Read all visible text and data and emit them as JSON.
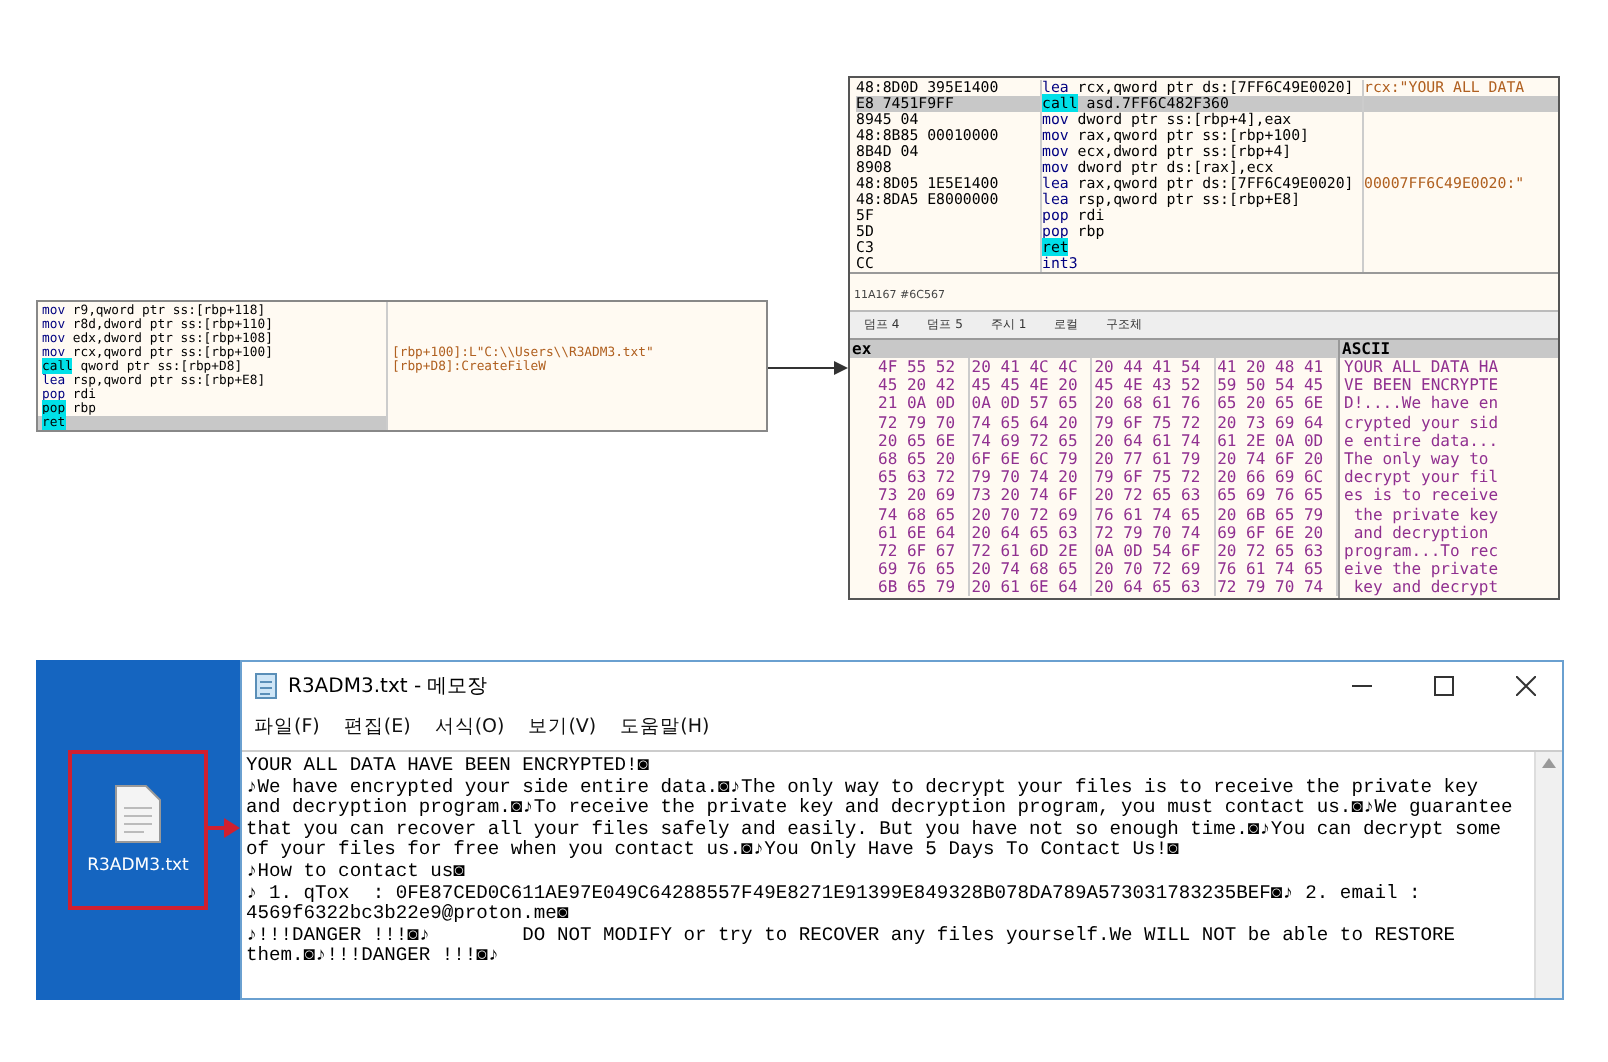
{
  "code_panel": {
    "rows": [
      {
        "mnemonic": "mov",
        "highlight": false,
        "operands": "r9,qword ptr ss:[rbp+118]",
        "comment": "",
        "selected": false
      },
      {
        "mnemonic": "mov",
        "highlight": false,
        "operands": "r8d,dword ptr ss:[rbp+110]",
        "comment": "",
        "selected": false
      },
      {
        "mnemonic": "mov",
        "highlight": false,
        "operands": "edx,dword ptr ss:[rbp+108]",
        "comment": "",
        "selected": false
      },
      {
        "mnemonic": "mov",
        "highlight": false,
        "operands": "rcx,qword ptr ss:[rbp+100]",
        "comment": "[rbp+100]:L\"C:\\\\Users\\\\R3ADM3.txt\"",
        "selected": false
      },
      {
        "mnemonic": "call",
        "highlight": true,
        "operands": "qword ptr ss:[rbp+D8]",
        "comment": "[rbp+D8]:CreateFileW",
        "selected": false
      },
      {
        "mnemonic": "lea",
        "highlight": false,
        "operands": "rsp,qword ptr ss:[rbp+E8]",
        "comment": "",
        "selected": false
      },
      {
        "mnemonic": "pop",
        "highlight": false,
        "operands": "rdi",
        "comment": "",
        "selected": false
      },
      {
        "mnemonic": "pop",
        "highlight": true,
        "operands": "rbp",
        "comment": "",
        "selected": false
      },
      {
        "mnemonic": "ret",
        "highlight": true,
        "operands": "",
        "comment": "",
        "selected": true
      }
    ]
  },
  "debugger": {
    "rows": [
      {
        "bytes": "48:8D0D 395E1400",
        "mnemonic": "lea",
        "highlight": false,
        "operands": "rcx,qword ptr ds:[7FF6C49E0020]",
        "comment": "rcx:\"YOUR ALL DATA",
        "selected": false
      },
      {
        "bytes": "E8 7451F9FF",
        "mnemonic": "call",
        "highlight": true,
        "operands": "asd.7FF6C482F360",
        "comment": "",
        "selected": true
      },
      {
        "bytes": "8945 04",
        "mnemonic": "mov",
        "highlight": false,
        "operands": "dword ptr ss:[rbp+4],eax",
        "comment": "",
        "selected": false
      },
      {
        "bytes": "48:8B85 00010000",
        "mnemonic": "mov",
        "highlight": false,
        "operands": "rax,qword ptr ss:[rbp+100]",
        "comment": "",
        "selected": false
      },
      {
        "bytes": "8B4D 04",
        "mnemonic": "mov",
        "highlight": false,
        "operands": "ecx,dword ptr ss:[rbp+4]",
        "comment": "",
        "selected": false
      },
      {
        "bytes": "8908",
        "mnemonic": "mov",
        "highlight": false,
        "operands": "dword ptr ds:[rax],ecx",
        "comment": "",
        "selected": false
      },
      {
        "bytes": "48:8D05 1E5E1400",
        "mnemonic": "lea",
        "highlight": false,
        "operands": "rax,qword ptr ds:[7FF6C49E0020]",
        "comment": "00007FF6C49E0020:\"",
        "selected": false
      },
      {
        "bytes": "48:8DA5 E8000000",
        "mnemonic": "lea",
        "highlight": false,
        "operands": "rsp,qword ptr ss:[rbp+E8]",
        "comment": "",
        "selected": false
      },
      {
        "bytes": "5F",
        "mnemonic": "pop",
        "highlight": false,
        "operands": "rdi",
        "comment": "",
        "selected": false
      },
      {
        "bytes": "5D",
        "mnemonic": "pop",
        "highlight": false,
        "operands": "rbp",
        "comment": "",
        "selected": false
      },
      {
        "bytes": "C3",
        "mnemonic": "ret",
        "highlight": true,
        "operands": "",
        "comment": "",
        "selected": false
      },
      {
        "bytes": "CC",
        "mnemonic": "int3",
        "highlight": false,
        "operands": "",
        "comment": "",
        "selected": false
      }
    ],
    "status": "11A167 #6C567",
    "tabs": [
      {
        "label": "덤프 4",
        "selected": false
      },
      {
        "label": "덤프 5",
        "selected": false
      },
      {
        "label": "주시 1",
        "selected": false
      },
      {
        "label": "로컬",
        "selected": false
      },
      {
        "label": "구조체",
        "selected": false
      }
    ],
    "hex_header": "ex",
    "ascii_header": "ASCII",
    "hex_rows": [
      {
        "groups": [
          "4F 55 52",
          "20 41 4C 4C",
          "20 44 41 54",
          "41 20 48 41"
        ],
        "ascii": "YOUR ALL DATA HA"
      },
      {
        "groups": [
          "45 20 42",
          "45 45 4E 20",
          "45 4E 43 52",
          "59 50 54 45"
        ],
        "ascii": "VE BEEN ENCRYPTE"
      },
      {
        "groups": [
          "21 0A 0D",
          "0A 0D 57 65",
          "20 68 61 76",
          "65 20 65 6E"
        ],
        "ascii": "D!....We have en"
      },
      {
        "groups": [
          "72 79 70",
          "74 65 64 20",
          "79 6F 75 72",
          "20 73 69 64"
        ],
        "ascii": "crypted your sid"
      },
      {
        "groups": [
          "20 65 6E",
          "74 69 72 65",
          "20 64 61 74",
          "61 2E 0A 0D"
        ],
        "ascii": "e entire data..."
      },
      {
        "groups": [
          "68 65 20",
          "6F 6E 6C 79",
          "20 77 61 79",
          "20 74 6F 20"
        ],
        "ascii": "The only way to "
      },
      {
        "groups": [
          "65 63 72",
          "79 70 74 20",
          "79 6F 75 72",
          "20 66 69 6C"
        ],
        "ascii": "decrypt your fil"
      },
      {
        "groups": [
          "73 20 69",
          "73 20 74 6F",
          "20 72 65 63",
          "65 69 76 65"
        ],
        "ascii": "es is to receive"
      },
      {
        "groups": [
          "74 68 65",
          "20 70 72 69",
          "76 61 74 65",
          "20 6B 65 79"
        ],
        "ascii": " the private key"
      },
      {
        "groups": [
          "61 6E 64",
          "20 64 65 63",
          "72 79 70 74",
          "69 6F 6E 20"
        ],
        "ascii": " and decryption "
      },
      {
        "groups": [
          "72 6F 67",
          "72 61 6D 2E",
          "0A 0D 54 6F",
          "20 72 65 63"
        ],
        "ascii": "program...To rec"
      },
      {
        "groups": [
          "69 76 65",
          "20 74 68 65",
          "20 70 72 69",
          "76 61 74 65"
        ],
        "ascii": "eive the private"
      },
      {
        "groups": [
          "6B 65 79",
          "20 61 6E 64",
          "20 64 65 63",
          "72 79 70 74"
        ],
        "ascii": " key and decrypt"
      }
    ]
  },
  "desktop": {
    "file_label": "R3ADM3.txt"
  },
  "notepad": {
    "title": "R3ADM3.txt - 메모장",
    "menu": [
      "파일(F)",
      "편집(E)",
      "서식(O)",
      "보기(V)",
      "도움말(H)"
    ],
    "lines": [
      "YOUR ALL DATA HAVE BEEN ENCRYPTED!◙",
      "♪We have encrypted your side entire data.◙♪The only way to decrypt your files is to receive the private key",
      "and decryption program.◙♪To receive the private key and decryption program, you must contact us.◙♪We guarantee",
      "that you can recover all your files safely and easily. But you have not so enough time.◙♪You can decrypt some",
      "of your files for free when you contact us.◙♪You Only Have 5 Days To Contact Us!◙",
      "♪How to contact us◙",
      "♪ 1. qTox  : 0FE87CED0C611AE97E049C64288557F49E8271E91399E849328B078DA789A573031783235BEF◙♪ 2. email :",
      "4569f6322bc3b22e9@proton.me◙",
      "♪!!!DANGER !!!◙♪        DO NOT MODIFY or try to RECOVER any files yourself.We WILL NOT be able to RESTORE",
      "them.◙♪!!!DANGER !!!◙♪"
    ]
  }
}
